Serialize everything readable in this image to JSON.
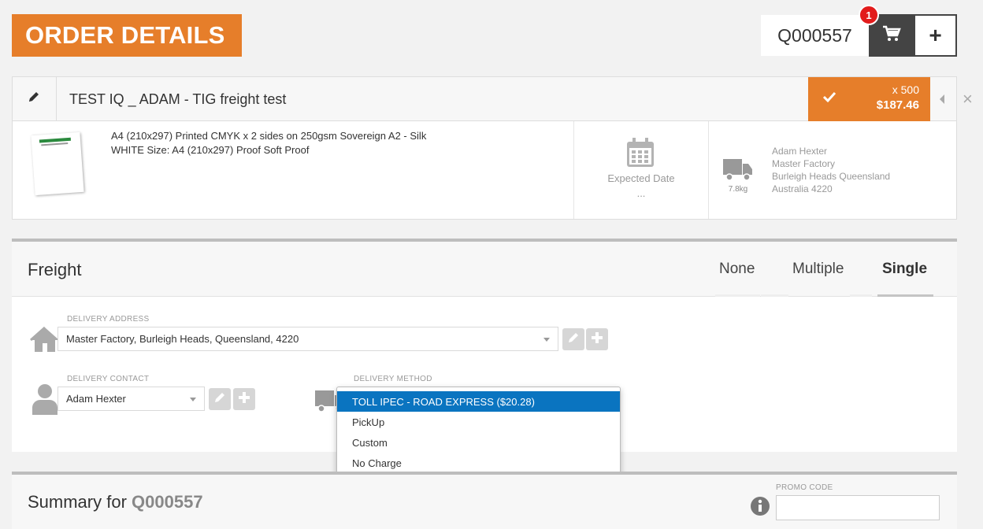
{
  "header": {
    "title": "ORDER DETAILS",
    "order_number": "Q000557",
    "cart_count": "1",
    "add_label": "+"
  },
  "item": {
    "title": "TEST IQ _ ADAM - TIG freight test",
    "quantity": "x 500",
    "price": "$187.46",
    "description_line1": "A4 (210x297) Printed CMYK x 2 sides on 250gsm Sovereign A2 - Silk",
    "description_line2": "WHITE Size: A4 (210x297) Proof Soft Proof",
    "expected_date_label": "Expected Date",
    "expected_date_value": "...",
    "weight": "7.8kg",
    "address_lines": [
      "Adam Hexter",
      "Master Factory",
      "Burleigh Heads Queensland",
      "Australia 4220"
    ]
  },
  "freight": {
    "title": "Freight",
    "tabs": [
      "None",
      "Multiple",
      "Single"
    ],
    "active_tab": "Single",
    "delivery_address_label": "DELIVERY ADDRESS",
    "delivery_address_value": "Master Factory, Burleigh Heads, Queensland, 4220",
    "delivery_contact_label": "DELIVERY CONTACT",
    "delivery_contact_value": "Adam Hexter",
    "delivery_method_label": "DELIVERY METHOD",
    "delivery_method_options": [
      "TOLL IPEC - ROAD EXPRESS ($20.28)",
      "PickUp",
      "Custom",
      "No Charge"
    ],
    "selected_option": "TOLL IPEC - ROAD EXPRESS ($20.28)"
  },
  "summary": {
    "title_prefix": "Summary for",
    "order_number": "Q000557",
    "promo_label": "PROMO CODE",
    "promo_value": ""
  },
  "colors": {
    "accent": "#e67e2a",
    "dark": "#444444",
    "selected": "#0a74c0",
    "badge": "#e21b1b"
  }
}
